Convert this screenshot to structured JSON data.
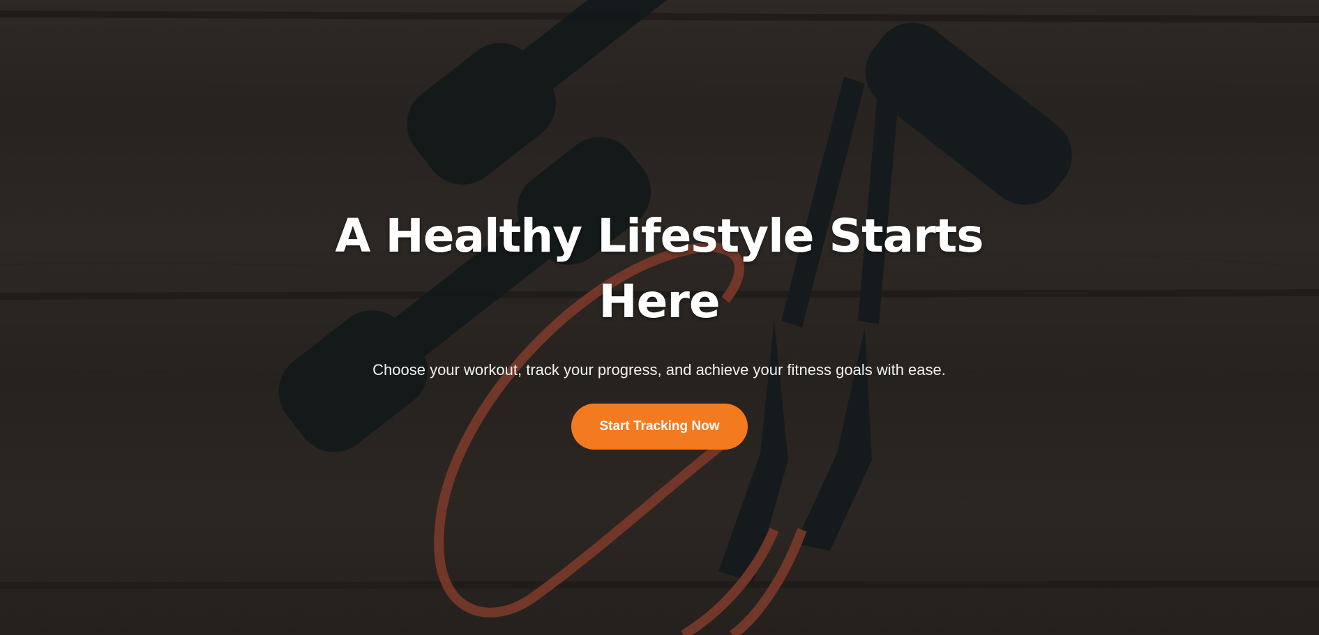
{
  "hero": {
    "headline": "A Healthy Lifestyle Starts Here",
    "subtext": "Choose your workout, track your progress, and achieve your fitness goals with ease.",
    "cta_label": "Start Tracking Now"
  },
  "background": {
    "image": "wooden-floor-with-dumbbells-and-resistance-band",
    "overlay_color": "#000000"
  },
  "colors": {
    "accent": "#f47a1f",
    "text": "#ffffff"
  }
}
